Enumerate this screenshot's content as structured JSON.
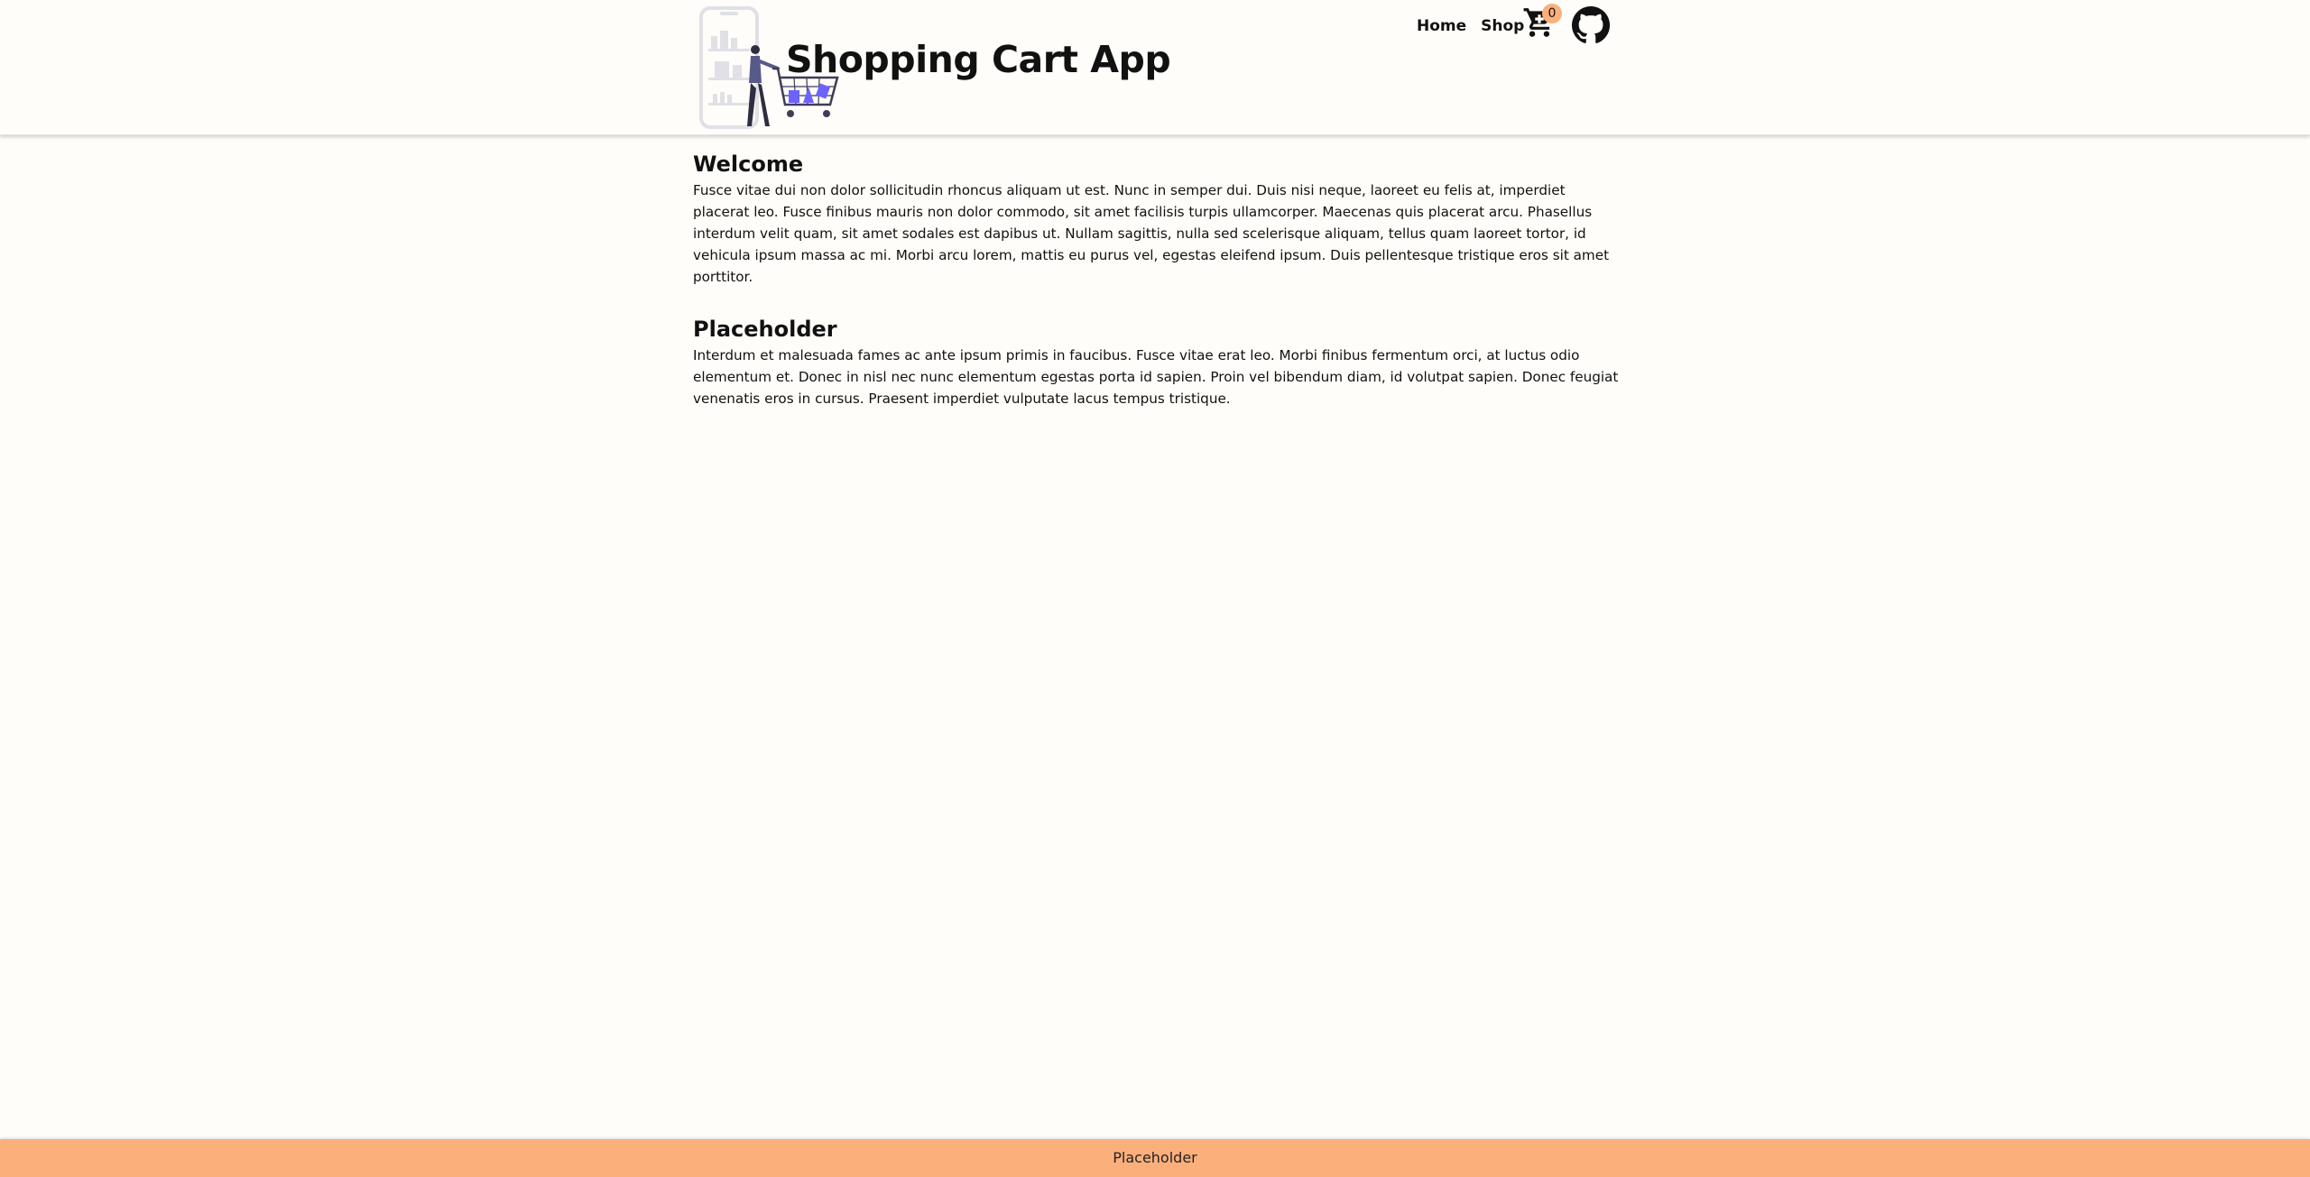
{
  "header": {
    "title": "Shopping Cart App",
    "nav": {
      "home_label": "Home",
      "shop_label": "Shop"
    },
    "cart": {
      "icon": "shopping-cart-icon",
      "count": "0"
    },
    "github_icon": "github-icon",
    "hero_image": "shopping-cart-illustration"
  },
  "main": {
    "sections": [
      {
        "heading": "Welcome",
        "body": "Fusce vitae dui non dolor sollicitudin rhoncus aliquam ut est. Nunc in semper dui. Duis nisi neque, laoreet eu felis at, imperdiet placerat leo. Fusce finibus mauris non dolor commodo, sit amet facilisis turpis ullamcorper. Maecenas quis placerat arcu. Phasellus interdum velit quam, sit amet sodales est dapibus ut. Nullam sagittis, nulla sed scelerisque aliquam, tellus quam laoreet tortor, id vehicula ipsum massa ac mi. Morbi arcu lorem, mattis eu purus vel, egestas eleifend ipsum. Duis pellentesque tristique eros sit amet porttitor."
      },
      {
        "heading": "Placeholder",
        "body": "Interdum et malesuada fames ac ante ipsum primis in faucibus. Fusce vitae erat leo. Morbi finibus fermentum orci, at luctus odio elementum et. Donec in nisl nec nunc elementum egestas porta id sapien. Proin vel bibendum diam, id volutpat sapien. Donec feugiat venenatis eros in cursus. Praesent imperdiet vulputate lacus tempus tristique."
      }
    ]
  },
  "footer": {
    "text": "Placeholder"
  },
  "colors": {
    "background": "#fffdf9",
    "accent": "#fbb07c",
    "illustration_purple": "#6c63ff",
    "illustration_gray": "#e0e0e6"
  }
}
